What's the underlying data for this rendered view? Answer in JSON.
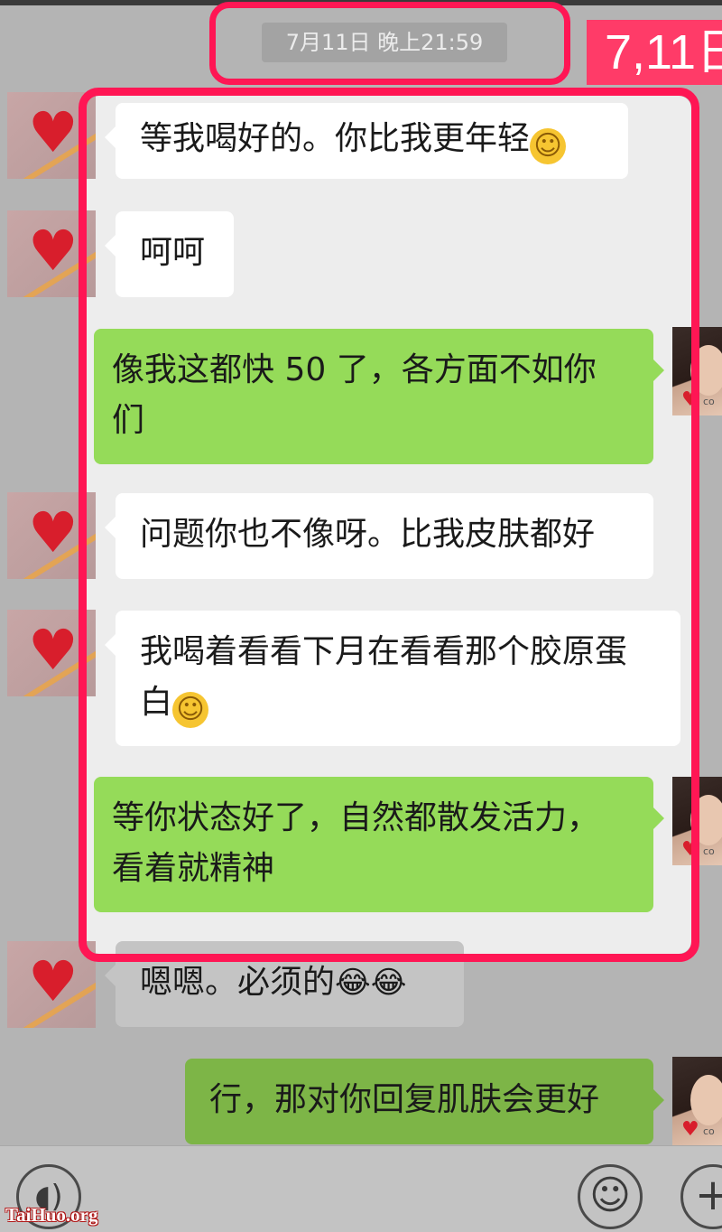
{
  "timestamp": "7月11日 晚上21:59",
  "date_tag": "7,11日",
  "messages": [
    {
      "side": "in",
      "text": "等我喝好的。你比我更年轻",
      "emoji": "☺"
    },
    {
      "side": "in",
      "text": "呵呵"
    },
    {
      "side": "out",
      "line1": "像我这都快 50 了，各方面不如你",
      "line2": "们"
    },
    {
      "side": "in",
      "text": "问题你也不像呀。比我皮肤都好"
    },
    {
      "side": "in",
      "line1": "我喝着看看下月在看看那个胶原蛋",
      "line2": "白",
      "emoji": "☺"
    },
    {
      "side": "out",
      "line1": "等你状态好了，自然都散发活力，",
      "line2": "看着就精神"
    },
    {
      "side": "in",
      "text": "嗯嗯。必须的",
      "emoji": "😂😂"
    },
    {
      "side": "out",
      "text": "行，那对你回复肌肤会更好"
    }
  ],
  "avatar_text": "co",
  "icons": {
    "voice": "voice-icon",
    "emoji": "emoji-icon",
    "plus": "plus-icon",
    "heart": "heart-icon"
  },
  "colors": {
    "highlight": "#ff1654",
    "sent_bubble": "#95db59",
    "received_bubble": "#ffffff"
  },
  "watermark": "TaiHuo.org"
}
